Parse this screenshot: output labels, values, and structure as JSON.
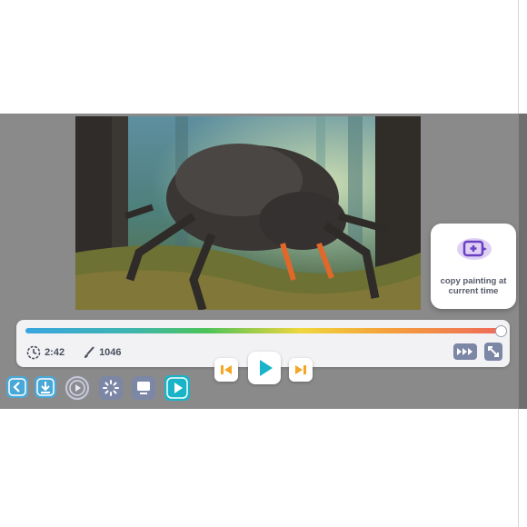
{
  "painting": {
    "alt": "beetle painting in a forest"
  },
  "copy_card": {
    "label": "copy painting at current time",
    "icon": "copy-add-icon"
  },
  "player": {
    "progress": 1.0,
    "time": "2:42",
    "strokes": "1046",
    "icons": {
      "time": "clock-icon",
      "strokes": "brush-icon",
      "speed": "fast-forward-icon",
      "fullscreen": "expand-icon"
    }
  },
  "controls": {
    "previous": "skip-back-icon",
    "play": "play-icon",
    "next": "skip-forward-icon"
  },
  "toolbar": {
    "items": [
      "back-icon",
      "download-icon",
      "replay-circle-icon",
      "loading-icon",
      "screen-icon",
      "play-icon"
    ]
  },
  "colors": {
    "accent": "#19b4c8",
    "skip": "#f5a623",
    "toolbar": "#7c87a6",
    "overlay": "#8a8a8a"
  }
}
